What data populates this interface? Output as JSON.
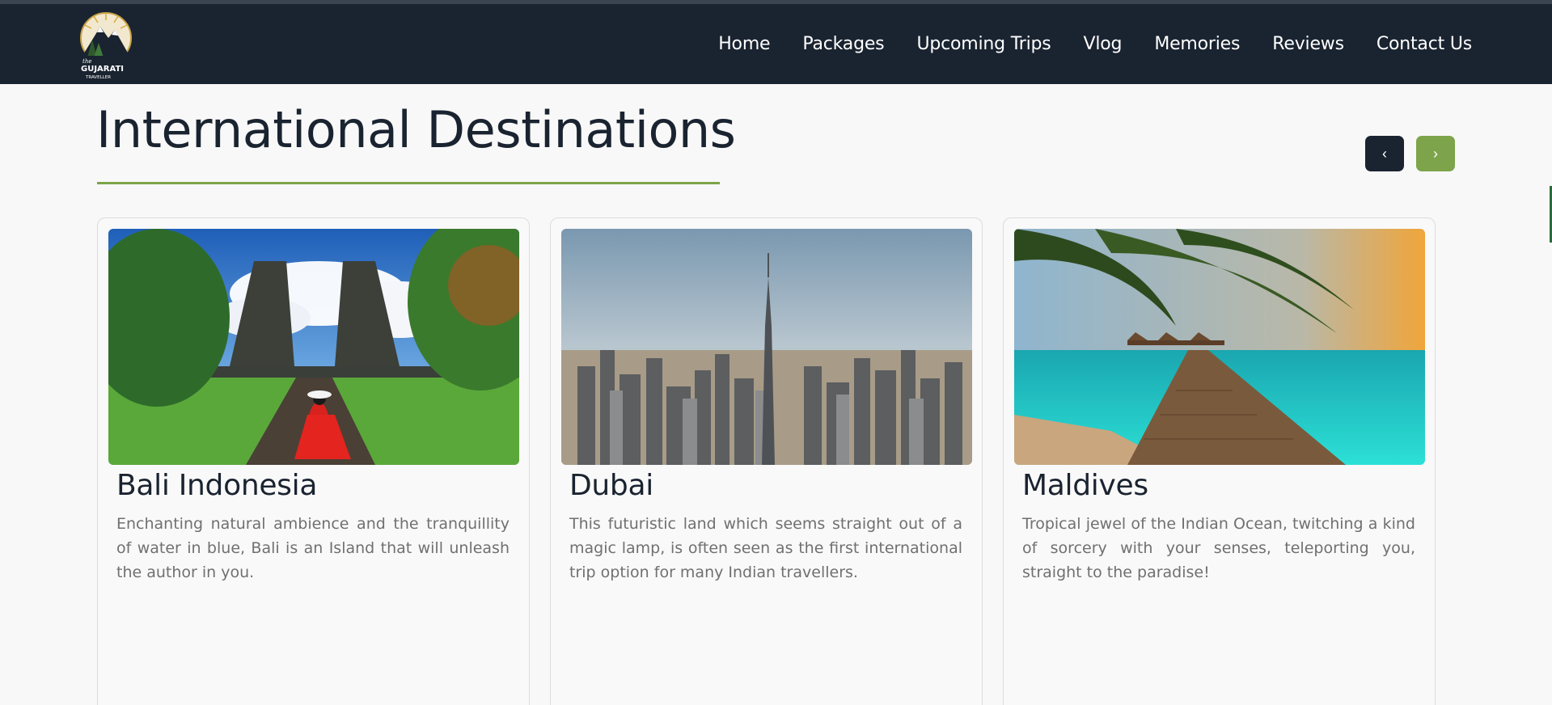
{
  "brand": {
    "logo_text_top": "the",
    "logo_text_main": "GUJARATI",
    "logo_text_sub": "TRAVELLER"
  },
  "nav": {
    "items": [
      {
        "label": "Home"
      },
      {
        "label": "Packages"
      },
      {
        "label": "Upcoming Trips"
      },
      {
        "label": "Vlog"
      },
      {
        "label": "Memories"
      },
      {
        "label": "Reviews"
      },
      {
        "label": "Contact Us"
      }
    ]
  },
  "section": {
    "title": "International Destinations",
    "prev_icon": "‹",
    "next_icon": "›"
  },
  "cards": [
    {
      "title": "Bali Indonesia",
      "description": "Enchanting natural ambience and the tranquillity of water in blue, Bali is an Island that will unleash the author in you."
    },
    {
      "title": "Dubai",
      "description": "This futuristic land which seems straight out of a magic lamp, is often seen as the first international trip option for many Indian travellers."
    },
    {
      "title": "Maldives",
      "description": "Tropical jewel of the Indian Ocean, twitching a kind of sorcery with your senses, teleporting you, straight to the paradise!"
    }
  ],
  "colors": {
    "navbar": "#1a2330",
    "accent_green": "#7da44a",
    "heading": "#1a2330",
    "body_text": "#707070"
  }
}
